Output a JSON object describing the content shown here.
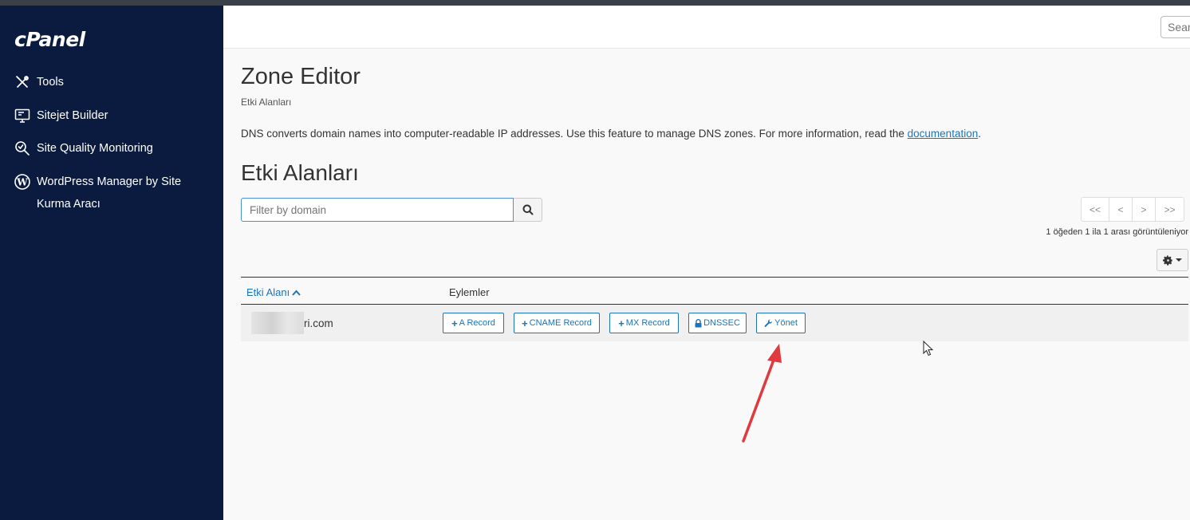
{
  "brand": {
    "logo": "cPanel"
  },
  "sidebar": {
    "items": [
      {
        "label": "Tools",
        "icon": "tools-icon"
      },
      {
        "label": "Sitejet Builder",
        "icon": "monitor-icon"
      },
      {
        "label": "Site Quality Monitoring",
        "icon": "search-check-icon"
      },
      {
        "label": "WordPress Manager by Site Kurma Aracı",
        "icon": "wordpress-icon"
      }
    ]
  },
  "header": {
    "search_placeholder": "Search"
  },
  "page": {
    "title": "Zone Editor",
    "breadcrumb": "Etki Alanları",
    "description": "DNS converts domain names into computer-readable IP addresses. Use this feature to manage DNS zones. For more information, read the ",
    "doc_link": "documentation",
    "description_end": ".",
    "section_title": "Etki Alanları"
  },
  "filter": {
    "placeholder": "Filter by domain"
  },
  "pager": {
    "first": "<<",
    "prev": "<",
    "next": ">",
    "last": ">>"
  },
  "page_info": "1 öğeden 1 ila 1 arası görüntüleniyor",
  "table": {
    "col_domain": "Etki Alanı",
    "col_actions": "Eylemler",
    "rows": [
      {
        "domain_visible": "ri.com",
        "actions": {
          "a_record": "A Record",
          "cname_record": "CNAME Record",
          "mx_record": "MX Record",
          "dnssec": "DNSSEC",
          "manage": "Yönet"
        }
      }
    ]
  },
  "colors": {
    "sidebar_bg": "#0b1b3f",
    "link": "#1a75bb",
    "annotation_arrow": "#e0393e"
  }
}
